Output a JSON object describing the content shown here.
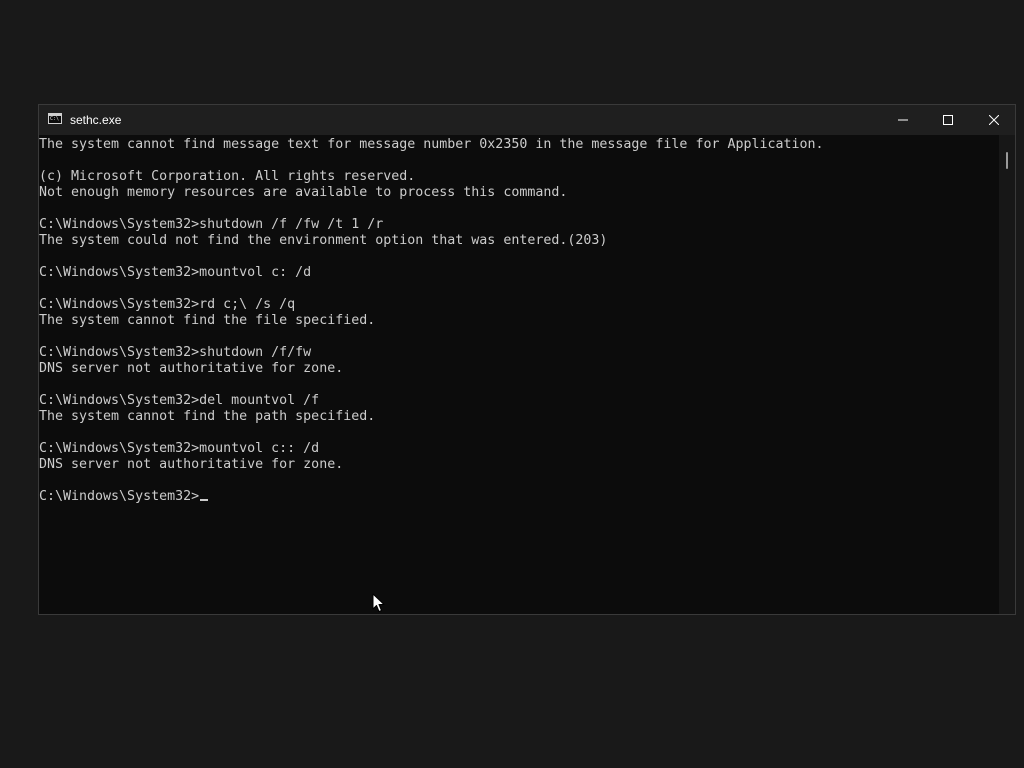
{
  "window": {
    "title": "sethc.exe",
    "icon": "console-icon",
    "icon_glyph": "C:\\",
    "controls": {
      "minimize_icon": "minimize-icon",
      "maximize_icon": "maximize-icon",
      "close_icon": "close-icon"
    }
  },
  "console": {
    "lines": [
      "The system cannot find message text for message number 0x2350 in the message file for Application.",
      "",
      "(c) Microsoft Corporation. All rights reserved.",
      "Not enough memory resources are available to process this command.",
      "",
      "C:\\Windows\\System32>shutdown /f /fw /t 1 /r",
      "The system could not find the environment option that was entered.(203)",
      "",
      "C:\\Windows\\System32>mountvol c: /d",
      "",
      "C:\\Windows\\System32>rd c;\\ /s /q",
      "The system cannot find the file specified.",
      "",
      "C:\\Windows\\System32>shutdown /f/fw",
      "DNS server not authoritative for zone.",
      "",
      "C:\\Windows\\System32>del mountvol /f",
      "The system cannot find the path specified.",
      "",
      "C:\\Windows\\System32>mountvol c:: /d",
      "DNS server not authoritative for zone.",
      ""
    ],
    "prompt": "C:\\Windows\\System32>"
  },
  "colors": {
    "console_background": "#0c0c0c",
    "console_text": "#cccccc",
    "titlebar_background": "#1f1f1f",
    "desktop_background": "#191919"
  }
}
